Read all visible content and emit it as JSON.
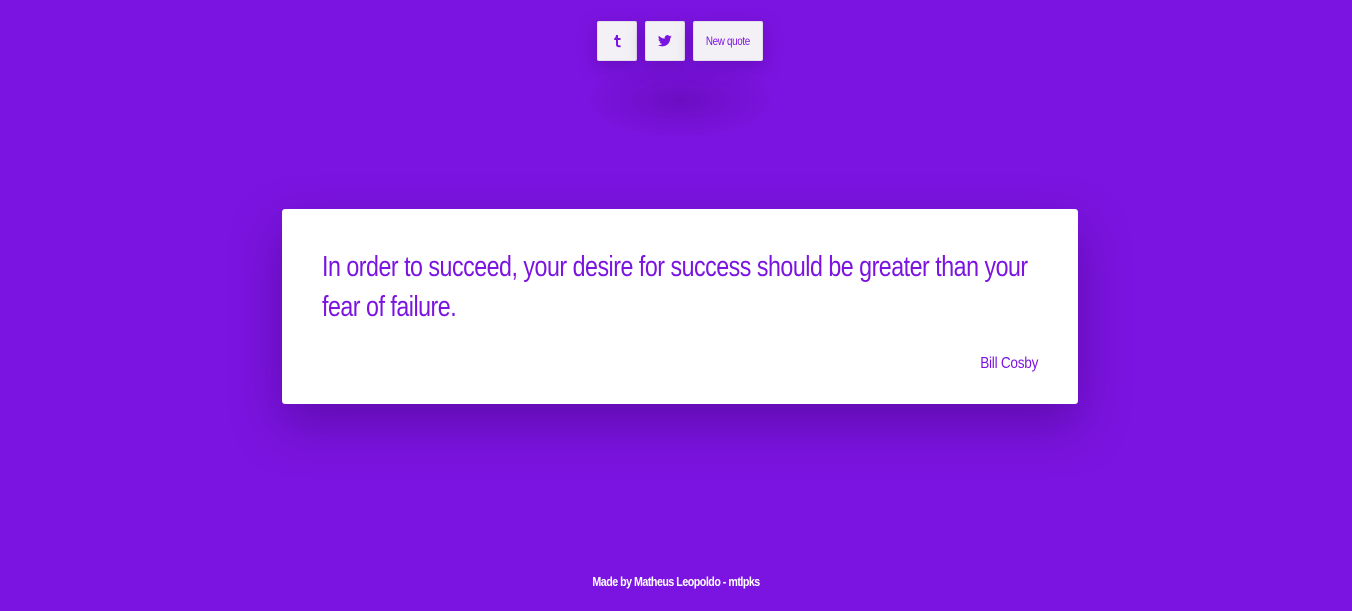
{
  "toolbar": {
    "tumblr_icon": "tumblr-icon",
    "twitter_icon": "twitter-icon",
    "new_quote_label": "New quote"
  },
  "quote": {
    "text": "In order to succeed, your desire for success should be greater than your fear of failure.",
    "author": "Bill Cosby"
  },
  "footer": {
    "credit": "Made by Matheus Leopoldo - mtlpks"
  },
  "colors": {
    "background": "#7b14e0",
    "accent": "#7b14e0",
    "card": "#ffffff",
    "button": "#f4f1f6"
  }
}
